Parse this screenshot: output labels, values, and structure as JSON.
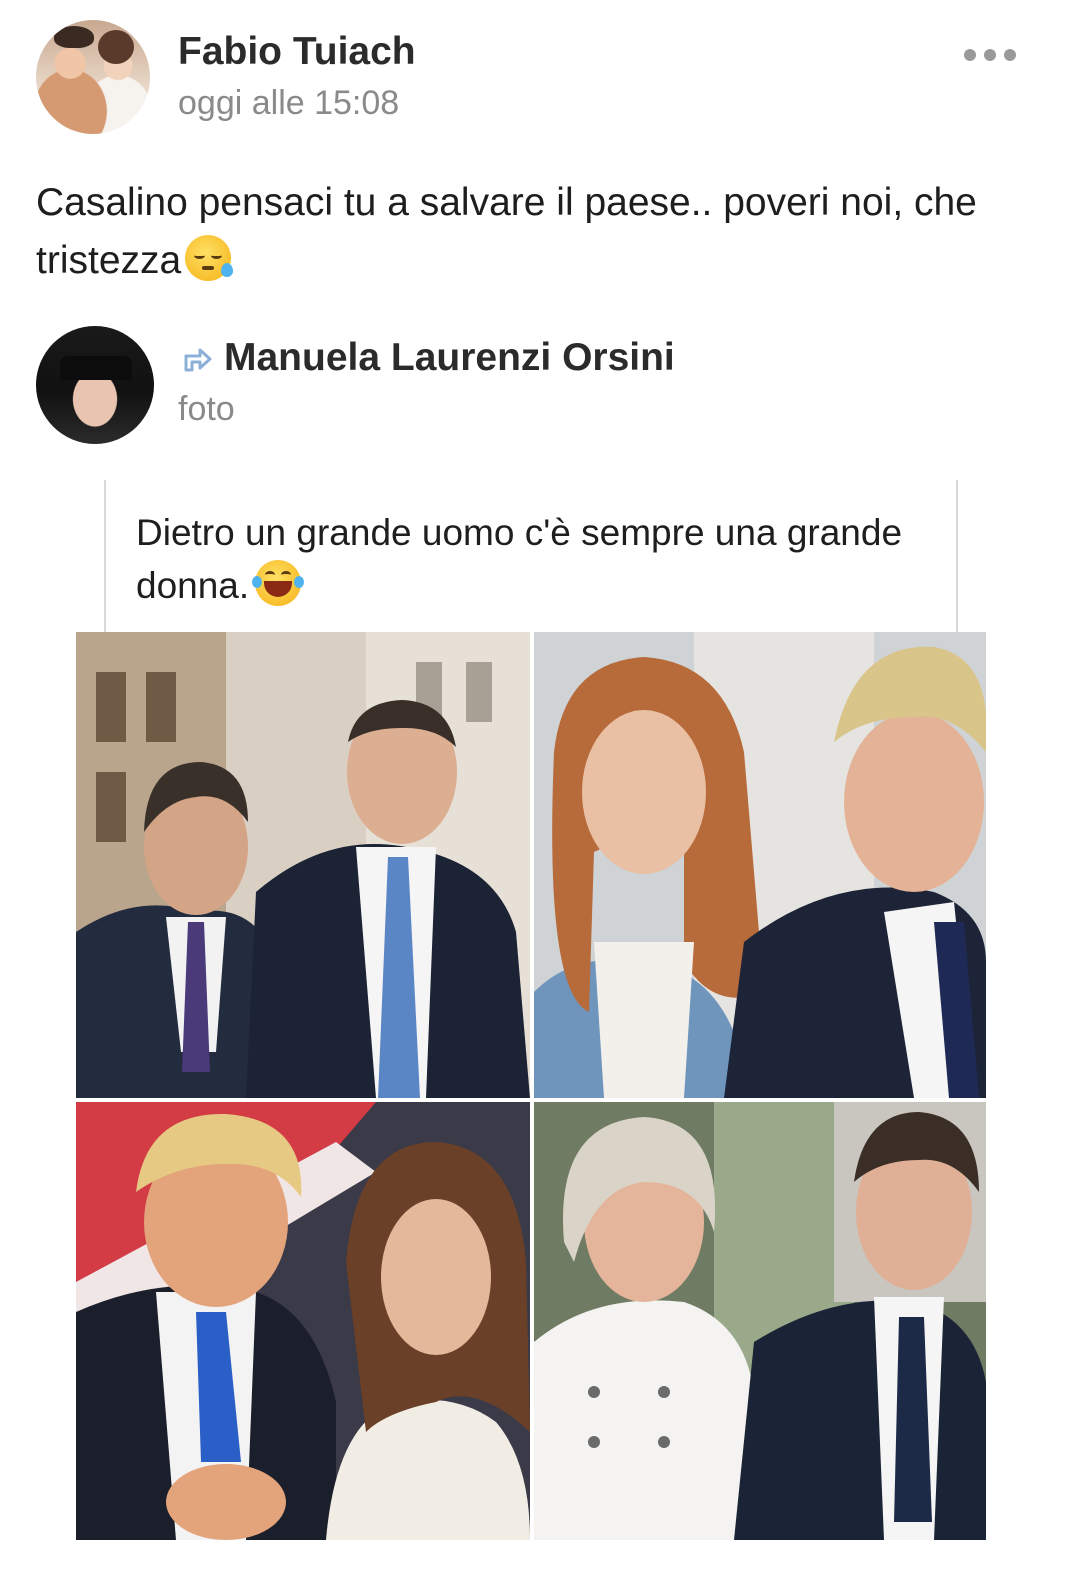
{
  "post": {
    "author": "Fabio Tuiach",
    "time": "oggi alle 15:08",
    "text": "Casalino pensaci tu a salvare il paese.. poveri noi, che tristezza",
    "text_emoji": "sleepy-face-emoji"
  },
  "shared": {
    "author": "Manuela Laurenzi Orsini",
    "type": "foto",
    "icon": "share-arrow-icon",
    "caption": "Dietro un grande uomo c'è sempre una grande donna.",
    "caption_emoji": "face-with-tears-of-joy-emoji"
  },
  "menu": {
    "icon": "more-options-icon"
  },
  "colors": {
    "text": "#1e1e1e",
    "secondary_text": "#8a8a8a",
    "share_icon": "#8db0d8"
  }
}
